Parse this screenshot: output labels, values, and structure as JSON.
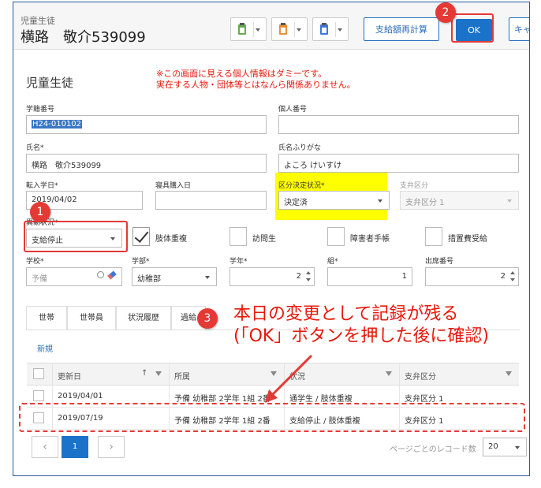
{
  "header": {
    "subtitle": "児童生徒",
    "name": "横路　敬介539099",
    "recalc_label": "支給額再計算",
    "ok_label": "OK",
    "cancel_label": "キャ"
  },
  "form": {
    "title": "児童生徒",
    "notice_line1": "※この画面に見える個人情報はダミーです。",
    "notice_line2": "実在する人物・団体等とはなんら関係ありません。",
    "student_no_label": "学籍番号",
    "student_no_value": "H24-010102",
    "personal_no_label": "個人番号",
    "personal_no_value": "",
    "name_label": "氏名*",
    "name_value": "横路　敬介539099",
    "kana_label": "氏名ふりがな",
    "kana_value": "よころ けいすけ",
    "transfer_date_label": "転入学日*",
    "transfer_date_value": "2019/04/02",
    "bedding_date_label": "寝具購入日",
    "bedding_date_value": "",
    "decision_label": "区分決定状況*",
    "decision_value": "決定済",
    "payment_class_label": "支弁区分",
    "payment_class_value": "支弁区分 1",
    "status_label": "異動状況*",
    "status_value": "支給停止",
    "checkboxes": [
      {
        "label": "肢体重複",
        "checked": true
      },
      {
        "label": "訪問生",
        "checked": false
      },
      {
        "label": "障害者手帳",
        "checked": false
      },
      {
        "label": "措置費受給",
        "checked": false
      }
    ],
    "school_label": "学校*",
    "school_placeholder": "予備",
    "dept_label": "学部*",
    "dept_value": "幼稚部",
    "year_label": "学年*",
    "year_value": "2",
    "class_label": "組*",
    "class_value": "1",
    "seat_label": "出席番号",
    "seat_value": "2"
  },
  "tabs": [
    "世帯",
    "世帯員",
    "状況履歴",
    "過給"
  ],
  "new_link": "新規",
  "grid": {
    "columns": [
      "更新日",
      "所属",
      "状況",
      "支弁区分"
    ],
    "rows": [
      {
        "date": "2019/04/01",
        "affil": "予備 幼稚部 2学年 1組 2番",
        "status": "通学生 / 肢体重複",
        "class": "支弁区分 1"
      },
      {
        "date": "2019/07/19",
        "affil": "予備 幼稚部 2学年 1組 2番",
        "status": "支給停止 / 肢体重複",
        "class": "支弁区分 1"
      }
    ]
  },
  "pager": {
    "current": "1",
    "prev": "‹",
    "next": "›",
    "size_label": "ページごとのレコード数",
    "size_value": "20"
  },
  "annotations": {
    "marker1": "1",
    "marker2": "2",
    "marker3": "3",
    "callout_line1": "本日の変更として記録が残る",
    "callout_line2": "(「OK」ボタンを押した後に確認)"
  },
  "colors": {
    "accent": "#1a73c9",
    "annotation_red": "#e53935",
    "highlight": "#ffff00"
  }
}
